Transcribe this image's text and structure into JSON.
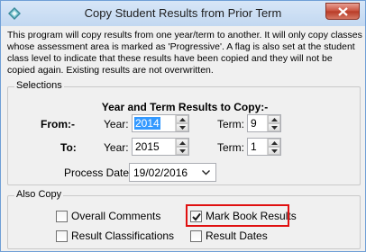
{
  "window": {
    "title": "Copy Student Results from Prior Term",
    "close_label": "Close"
  },
  "description": "This program will copy results from one year/term to another.  It will only copy classes whose assessment area is marked as 'Progressive'.  A flag is also set at the student class level to indicate that these results have been copied and they will not be copied again.  Existing results are not overwritten.",
  "selections": {
    "group_label": "Selections",
    "heading": "Year and Term Results to Copy:-",
    "from": {
      "label": "From:-",
      "year_label": "Year:",
      "year": "2014",
      "term_label": "Term:",
      "term": "9"
    },
    "to": {
      "label": "To:",
      "year_label": "Year:",
      "year": "2015",
      "term_label": "Term:",
      "term": "1"
    },
    "process_date": {
      "label": "Process Date:",
      "value": "19/02/2016"
    }
  },
  "also_copy": {
    "group_label": "Also Copy",
    "options": [
      {
        "label": "Overall Comments",
        "checked": false
      },
      {
        "label": "Mark Book Results",
        "checked": true
      },
      {
        "label": "Result Classifications",
        "checked": false
      },
      {
        "label": "Result Dates",
        "checked": false
      }
    ]
  },
  "colors": {
    "title_bar": "#c8dcf3",
    "close_button": "#c8503c",
    "selection_highlight": "#3399ff",
    "annotation_box": "#e01010"
  },
  "icons": {
    "app": "diamond-app-icon",
    "close": "close-icon",
    "spin_up": "spin-up-arrow-icon",
    "spin_down": "spin-down-arrow-icon",
    "dropdown": "chevron-down-icon",
    "check": "checkmark-icon"
  }
}
